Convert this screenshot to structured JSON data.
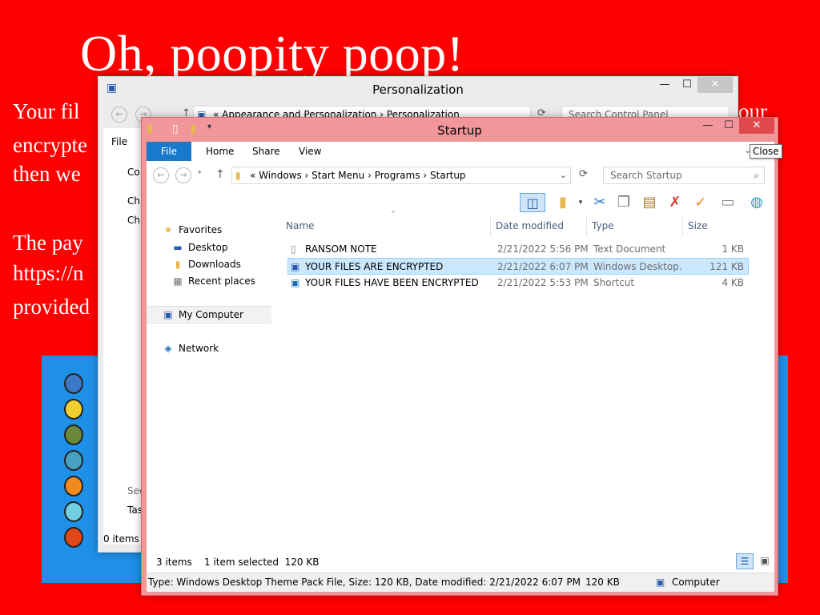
{
  "wallpaper": {
    "title": "Oh, poopity poop!",
    "lines": [
      "Your fil",
      "encrypte",
      "then we",
      "The pay",
      "https://n",
      "provided"
    ],
    "right_fragment": "our"
  },
  "back_window": {
    "title": "Personalization",
    "breadcrumb": [
      "Appearance and Personalization",
      "Personalization"
    ],
    "search_placeholder": "Search Control Panel",
    "menu_file": "File",
    "side_text": [
      "Co",
      "Ch",
      "Ch",
      "See",
      "Tas"
    ],
    "status": "0 items",
    "controls": {
      "minimize": "—",
      "maximize": "☐",
      "close": "✕"
    }
  },
  "front_window": {
    "title": "Startup",
    "tabs": [
      "File",
      "Home",
      "Share",
      "View"
    ],
    "breadcrumb": [
      "Windows",
      "Start Menu",
      "Programs",
      "Startup"
    ],
    "search_placeholder": "Search Startup",
    "controls": {
      "minimize": "—",
      "maximize": "☐",
      "close": "✕"
    },
    "tooltip": "Close",
    "nav": {
      "favorites": "Favorites",
      "desktop": "Desktop",
      "downloads": "Downloads",
      "recent": "Recent places",
      "computer": "My Computer",
      "network": "Network"
    },
    "columns": [
      "Name",
      "Date modified",
      "Type",
      "Size"
    ],
    "files": [
      {
        "name": "RANSOM NOTE",
        "date": "2/21/2022 5:56 PM",
        "type": "Text Document",
        "size": "1 KB"
      },
      {
        "name": "YOUR FILES ARE ENCRYPTED",
        "date": "2/21/2022 6:07 PM",
        "type": "Windows Desktop...",
        "size": "121 KB"
      },
      {
        "name": "YOUR FILES HAVE BEEN ENCRYPTED",
        "date": "2/21/2022 5:53 PM",
        "type": "Shortcut",
        "size": "4 KB"
      }
    ],
    "status": {
      "items": "3 items",
      "selected": "1 item selected  120 KB"
    },
    "details": {
      "info": "Type: Windows Desktop Theme Pack File, Size: 120 KB, Date modified: 2/21/2022 6:07 PM",
      "size": "120 KB",
      "location": "Computer"
    }
  }
}
